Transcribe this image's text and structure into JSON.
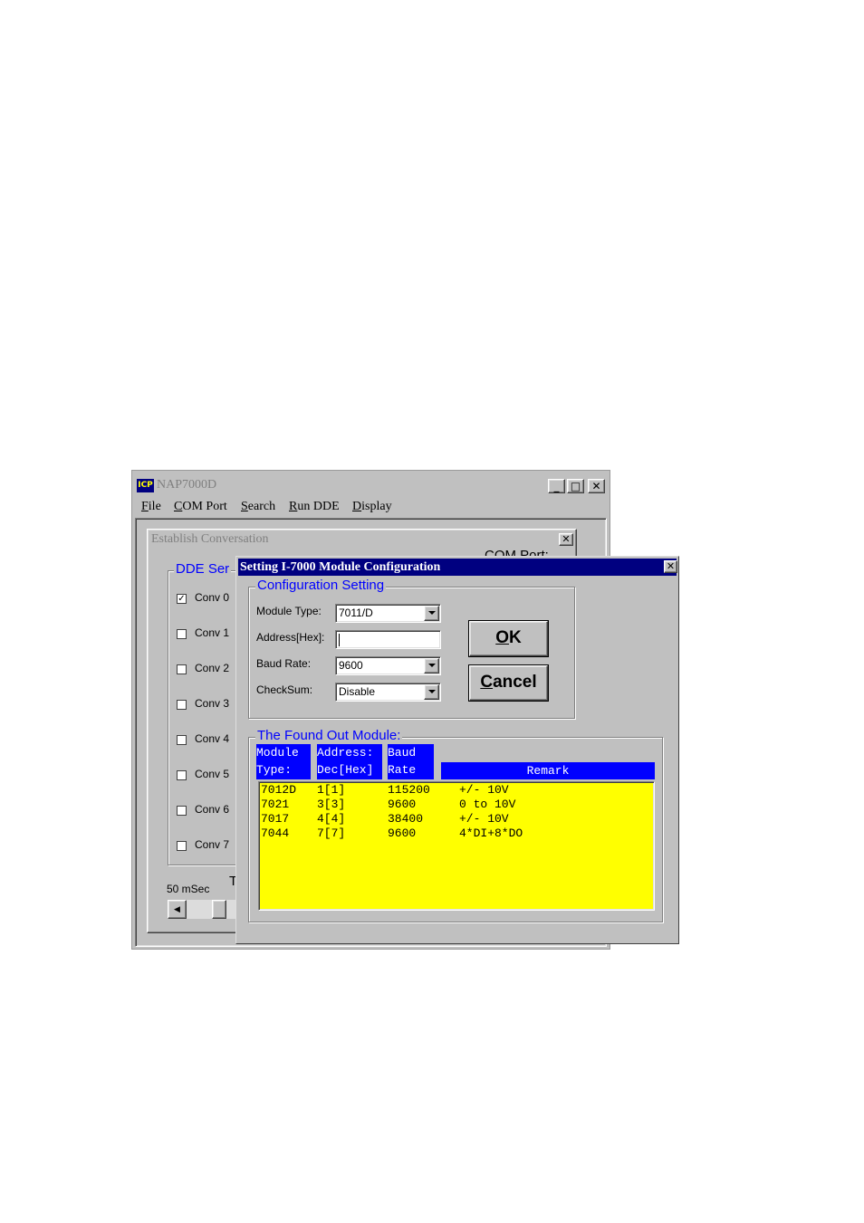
{
  "main_window": {
    "title": "NAP7000D",
    "logo": "ICP",
    "menu": [
      {
        "label": "File",
        "key": "F",
        "rest": "ile"
      },
      {
        "label": "COM Port",
        "key": "C",
        "rest": "OM Port"
      },
      {
        "label": "Search",
        "key": "S",
        "rest": "earch"
      },
      {
        "label": "Run DDE",
        "key": "R",
        "rest": "un DDE"
      },
      {
        "label": "Display",
        "key": "D",
        "rest": "isplay"
      }
    ],
    "minimize_glyph": "_",
    "maximize_glyph": "□",
    "close_glyph": "✕"
  },
  "conversation_window": {
    "title": "Establish Conversation",
    "com_port_label": "COM Port:",
    "group_label": "DDE Ser",
    "conversations": [
      {
        "label": "Conv 0",
        "checked": true
      },
      {
        "label": "Conv 1",
        "checked": false
      },
      {
        "label": "Conv 2",
        "checked": false
      },
      {
        "label": "Conv 3",
        "checked": false
      },
      {
        "label": "Conv 4",
        "checked": false
      },
      {
        "label": "Conv 5",
        "checked": false
      },
      {
        "label": "Conv 6",
        "checked": false
      },
      {
        "label": "Conv 7",
        "checked": false
      }
    ],
    "interval_label": "50 mSec",
    "t_label": "T",
    "close_glyph": "✕"
  },
  "dialog": {
    "title": "Setting I-7000 Module Configuration",
    "close_glyph": "✕",
    "config_group": "Configuration Setting",
    "module_type_label": "Module Type:",
    "module_type_value": "7011/D",
    "address_label": "Address[Hex]:",
    "address_value": "",
    "baud_rate_label": "Baud Rate:",
    "baud_rate_value": "9600",
    "checksum_label": "CheckSum:",
    "checksum_value": "Disable",
    "ok_label": "OK",
    "ok_key": "O",
    "ok_rest": "K",
    "cancel_label": "Cancel",
    "cancel_key": "C",
    "cancel_rest": "ancel",
    "found_group": "The Found Out Module:",
    "columns": {
      "module_line1": "Module",
      "module_line2": "Type:",
      "address_line1": "Address:",
      "address_line2": "Dec[Hex]",
      "baud_line1": "Baud",
      "baud_line2": "Rate",
      "remark": "Remark"
    },
    "modules": [
      {
        "type": "7012D",
        "address": "1[1]",
        "baud": "115200",
        "remark": "+/- 10V"
      },
      {
        "type": "7021",
        "address": "3[3]",
        "baud": "9600",
        "remark": "0 to 10V"
      },
      {
        "type": "7017",
        "address": "4[4]",
        "baud": "38400",
        "remark": "+/- 10V"
      },
      {
        "type": "7044",
        "address": "7[7]",
        "baud": "9600",
        "remark": "4*DI+8*DO"
      }
    ]
  }
}
